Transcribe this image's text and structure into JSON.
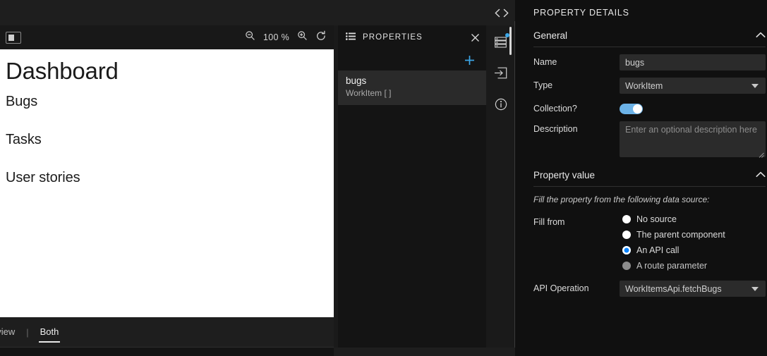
{
  "editor": {
    "panel_toggle_icon": "layout-panel-icon",
    "code_icon": "code-brackets-icon",
    "toolbar": {
      "zoom_out_icon": "zoom-out-icon",
      "zoom_level": "100 %",
      "zoom_in_icon": "zoom-in-icon",
      "refresh_icon": "refresh-icon"
    },
    "canvas": {
      "heading": "Dashboard",
      "items": [
        "Bugs",
        "Tasks",
        "User stories"
      ]
    },
    "view_tabs": [
      {
        "label": "eview",
        "active": false
      },
      {
        "label": "Both",
        "active": true
      }
    ],
    "tab_separator": "|"
  },
  "properties_panel": {
    "list_icon": "list-icon",
    "title": "PROPERTIES",
    "close_icon": "close-icon",
    "add_icon": "plus-icon",
    "items": [
      {
        "name": "bugs",
        "type": "WorkItem [ ]",
        "selected": true
      }
    ]
  },
  "icon_rail": {
    "buttons": [
      {
        "icon": "properties-list-icon",
        "badge": true
      },
      {
        "icon": "import-into-box-icon",
        "badge": false
      },
      {
        "icon": "info-circle-icon",
        "badge": false
      }
    ]
  },
  "details_panel": {
    "title": "PROPERTY DETAILS",
    "general": {
      "section_label": "General",
      "chevron_icon": "chevron-up-icon",
      "name_label": "Name",
      "name_value": "bugs",
      "type_label": "Type",
      "type_value": "WorkItem",
      "collection_label": "Collection?",
      "collection_on": true,
      "description_label": "Description",
      "description_placeholder": "Enter an optional description here"
    },
    "property_value": {
      "section_label": "Property value",
      "chevron_icon": "chevron-up-icon",
      "hint": "Fill the property from the following data source:",
      "fill_from_label": "Fill from",
      "options": [
        {
          "label": "No source",
          "state": "unchecked"
        },
        {
          "label": "The parent component",
          "state": "unchecked"
        },
        {
          "label": "An API call",
          "state": "checked"
        },
        {
          "label": "A route parameter",
          "state": "disabled"
        }
      ],
      "api_operation_label": "API Operation",
      "api_operation_value": "WorkItemsApi.fetchBugs"
    }
  },
  "colors": {
    "accent_blue": "#3ba7e8",
    "radio_blue": "#0a84ff",
    "toggle_blue": "#6cb3e8"
  }
}
